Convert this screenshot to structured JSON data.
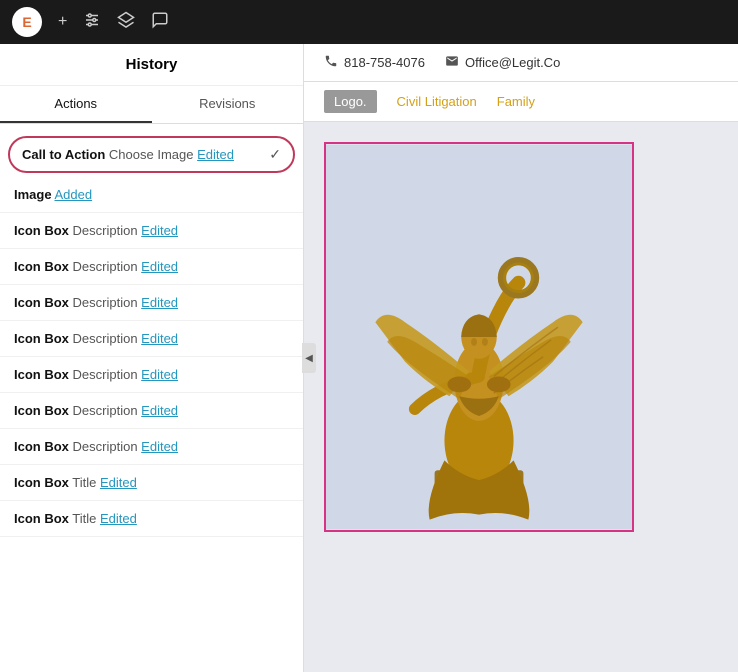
{
  "toolbar": {
    "logo": "E",
    "icons": [
      "+",
      "sliders",
      "layers",
      "chat"
    ]
  },
  "left_panel": {
    "title": "History",
    "tabs": [
      {
        "label": "Actions",
        "active": true
      },
      {
        "label": "Revisions",
        "active": false
      }
    ],
    "history_items": [
      {
        "type": "Call to Action",
        "detail": "Choose Image",
        "link_label": "Edited",
        "highlighted": true
      },
      {
        "type": "Image",
        "detail": "",
        "link_label": "Added",
        "highlighted": false
      },
      {
        "type": "Icon Box",
        "detail": "Description",
        "link_label": "Edited",
        "highlighted": false
      },
      {
        "type": "Icon Box",
        "detail": "Description",
        "link_label": "Edited",
        "highlighted": false
      },
      {
        "type": "Icon Box",
        "detail": "Description",
        "link_label": "Edited",
        "highlighted": false
      },
      {
        "type": "Icon Box",
        "detail": "Description",
        "link_label": "Edited",
        "highlighted": false
      },
      {
        "type": "Icon Box",
        "detail": "Description",
        "link_label": "Edited",
        "highlighted": false
      },
      {
        "type": "Icon Box",
        "detail": "Description",
        "link_label": "Edited",
        "highlighted": false
      },
      {
        "type": "Icon Box",
        "detail": "Description",
        "link_label": "Edited",
        "highlighted": false
      },
      {
        "type": "Icon Box",
        "detail": "Title",
        "link_label": "Edited",
        "highlighted": false
      },
      {
        "type": "Icon Box",
        "detail": "Title",
        "link_label": "Edited",
        "highlighted": false
      }
    ]
  },
  "site": {
    "phone": "818-758-4076",
    "email": "Office@Legit.Co",
    "logo_label": "Logo.",
    "nav_links": [
      "Civil Litigation",
      "Family"
    ]
  },
  "colors": {
    "nav_link": "#d4a017",
    "highlight_border": "#c0385a",
    "edited_link": "#2596be"
  }
}
